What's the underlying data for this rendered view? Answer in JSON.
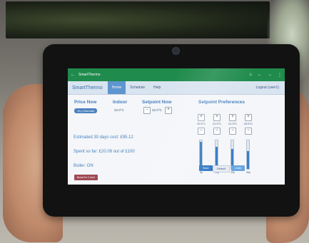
{
  "statusbar": {
    "app_title": "SmartThermo",
    "icons": [
      "back-arrow-icon",
      "home-icon",
      "previous-icon",
      "forward-icon",
      "overflow-menu-icon"
    ]
  },
  "navbar": {
    "brand": "SmartThermo",
    "tabs": [
      {
        "label": "Home",
        "active": true
      },
      {
        "label": "Schedule",
        "active": false
      },
      {
        "label": "Help",
        "active": false
      }
    ],
    "logout": "Logout (user1)"
  },
  "price": {
    "heading": "Price Now",
    "badge": "13 p (Normal)"
  },
  "indoor": {
    "heading": "Indoor",
    "value": "22.0°C"
  },
  "setpoint": {
    "heading": "Setpoint Now",
    "value": "22.0°C"
  },
  "preferences": {
    "heading": "Setpoint Preferences",
    "items": [
      {
        "value": "22.5°C",
        "label": "9p",
        "level": 0.95
      },
      {
        "value": "21.5°C",
        "label": "15p",
        "level": 0.78
      },
      {
        "value": "21.0°C",
        "label": "22p",
        "level": 0.7
      },
      {
        "value": "20.5°C",
        "label": "35p",
        "level": 0.62
      }
    ],
    "buttons": {
      "save": "Save",
      "default": "Default",
      "undo": "Undo"
    }
  },
  "info": {
    "estimate": "Estimated 30 days cost: £95.12",
    "spent": "Spent so far: £20.08 out of £100",
    "boiler": "Boiler: ON",
    "boost": "Boost for 1 hour"
  },
  "colors": {
    "statusbar": "#1f8b4c",
    "accent": "#4a80bd",
    "slider_fill": "#3b7ec8"
  }
}
